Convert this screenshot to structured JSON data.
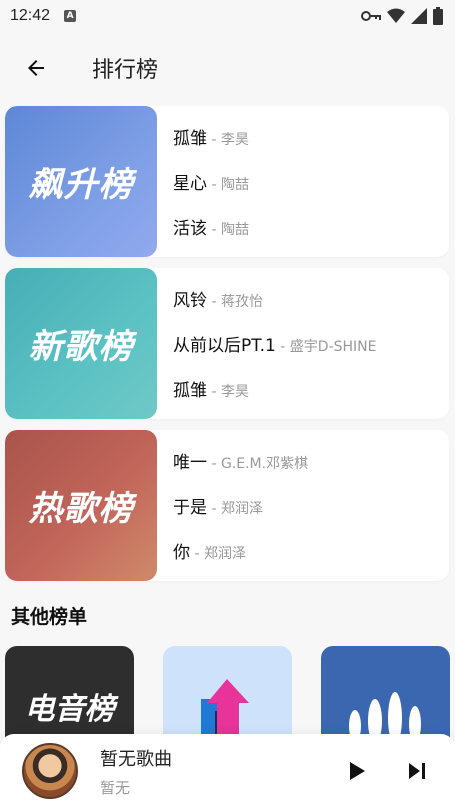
{
  "statusbar": {
    "time": "12:42",
    "notif_icon": "A"
  },
  "header": {
    "title": "排行榜"
  },
  "rank_cards": [
    {
      "cover_text": "飙升榜",
      "tracks": [
        {
          "name": "孤雏",
          "artist": " - 李昊"
        },
        {
          "name": "星心",
          "artist": " - 陶喆"
        },
        {
          "name": "活该",
          "artist": " - 陶喆"
        }
      ]
    },
    {
      "cover_text": "新歌榜",
      "tracks": [
        {
          "name": "风铃",
          "artist": " - 蒋孜怡"
        },
        {
          "name": "从前以后PT.1",
          "artist": " - 盛宇D-SHINE"
        },
        {
          "name": "孤雏",
          "artist": " - 李昊"
        }
      ]
    },
    {
      "cover_text": "热歌榜",
      "tracks": [
        {
          "name": "唯一",
          "artist": " - G.E.M.邓紫棋"
        },
        {
          "name": "于是",
          "artist": " - 郑润泽"
        },
        {
          "name": "你",
          "artist": " - 郑润泽"
        }
      ]
    }
  ],
  "others": {
    "section_title": "其他榜单",
    "cards": [
      {
        "cover_text": "电音榜"
      }
    ]
  },
  "player": {
    "title": "暂无歌曲",
    "subtitle": "暂无"
  },
  "colors": {
    "background": "#f7f7f7",
    "artist_gray": "#999999"
  }
}
